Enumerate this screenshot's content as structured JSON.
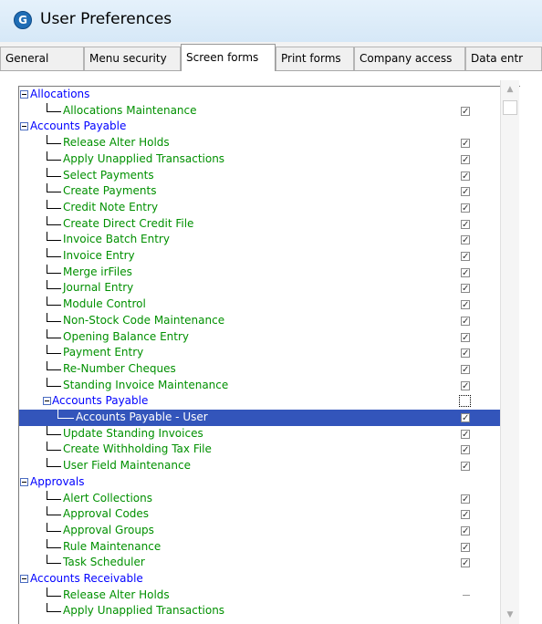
{
  "window": {
    "title": "User Preferences",
    "icon_letter": "G",
    "icon": "app-logo-icon"
  },
  "tabs": [
    {
      "label": "General"
    },
    {
      "label": "Menu security"
    },
    {
      "label": "Screen forms",
      "active": true
    },
    {
      "label": "Print forms"
    },
    {
      "label": "Company access"
    },
    {
      "label": "Data entr"
    }
  ],
  "tree": {
    "rows": [
      {
        "label": "Allocations",
        "type": "parent",
        "level": 0,
        "check": "none"
      },
      {
        "label": "Allocations Maintenance",
        "type": "child",
        "level": 1,
        "check": "checked"
      },
      {
        "label": "Accounts Payable",
        "type": "parent",
        "level": 0,
        "check": "none"
      },
      {
        "label": "Release Alter Holds",
        "type": "child",
        "level": 1,
        "check": "checked"
      },
      {
        "label": "Apply Unapplied Transactions",
        "type": "child",
        "level": 1,
        "check": "checked"
      },
      {
        "label": "Select Payments",
        "type": "child",
        "level": 1,
        "check": "checked"
      },
      {
        "label": "Create Payments",
        "type": "child",
        "level": 1,
        "check": "checked"
      },
      {
        "label": "Credit Note Entry",
        "type": "child",
        "level": 1,
        "check": "checked"
      },
      {
        "label": "Create Direct Credit File",
        "type": "child",
        "level": 1,
        "check": "checked"
      },
      {
        "label": "Invoice Batch Entry",
        "type": "child",
        "level": 1,
        "check": "checked"
      },
      {
        "label": "Invoice Entry",
        "type": "child",
        "level": 1,
        "check": "checked"
      },
      {
        "label": "Merge irFiles",
        "type": "child",
        "level": 1,
        "check": "checked"
      },
      {
        "label": "Journal Entry",
        "type": "child",
        "level": 1,
        "check": "checked"
      },
      {
        "label": "Module Control",
        "type": "child",
        "level": 1,
        "check": "checked"
      },
      {
        "label": "Non-Stock Code Maintenance",
        "type": "child",
        "level": 1,
        "check": "checked"
      },
      {
        "label": "Opening Balance Entry",
        "type": "child",
        "level": 1,
        "check": "checked"
      },
      {
        "label": "Payment Entry",
        "type": "child",
        "level": 1,
        "check": "checked"
      },
      {
        "label": "Re-Number Cheques",
        "type": "child",
        "level": 1,
        "check": "checked"
      },
      {
        "label": "Standing Invoice Maintenance",
        "type": "child",
        "level": 1,
        "check": "checked"
      },
      {
        "label": "Accounts Payable",
        "type": "child-parent",
        "level": 1,
        "check": "focus-unchecked"
      },
      {
        "label": "Accounts Payable - User",
        "type": "child",
        "level": 2,
        "check": "checked",
        "selected": true
      },
      {
        "label": "Update Standing Invoices",
        "type": "child",
        "level": 1,
        "check": "checked"
      },
      {
        "label": "Create Withholding Tax File",
        "type": "child",
        "level": 1,
        "check": "checked"
      },
      {
        "label": "User Field Maintenance",
        "type": "child",
        "level": 1,
        "check": "checked"
      },
      {
        "label": "Approvals",
        "type": "parent",
        "level": 0,
        "check": "none"
      },
      {
        "label": "Alert Collections",
        "type": "child",
        "level": 1,
        "check": "checked"
      },
      {
        "label": "Approval Codes",
        "type": "child",
        "level": 1,
        "check": "checked"
      },
      {
        "label": "Approval Groups",
        "type": "child",
        "level": 1,
        "check": "checked"
      },
      {
        "label": "Rule Maintenance",
        "type": "child",
        "level": 1,
        "check": "checked"
      },
      {
        "label": "Task Scheduler",
        "type": "child",
        "level": 1,
        "check": "checked"
      },
      {
        "label": "Accounts Receivable",
        "type": "parent",
        "level": 0,
        "check": "none"
      },
      {
        "label": "Release Alter Holds",
        "type": "child",
        "level": 1,
        "check": "dash"
      },
      {
        "label": "Apply Unapplied Transactions",
        "type": "child",
        "level": 1,
        "check": "none"
      }
    ],
    "check_glyph": "✓"
  },
  "scrollbar": {
    "up_icon": "▲",
    "down_icon": "▼"
  }
}
